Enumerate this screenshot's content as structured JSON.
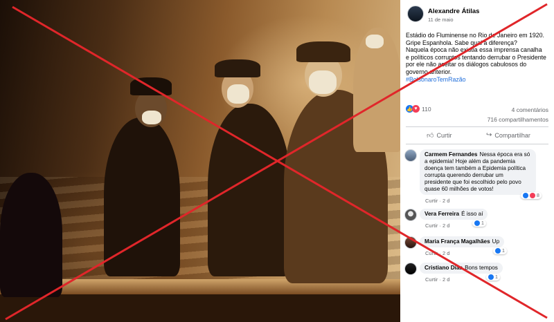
{
  "post": {
    "author": "Alexandre Átilas",
    "time": "11 de maio",
    "text_lines": [
      "Estádio do Fluminense no Rio de Janeiro em 1920.",
      "Gripe Espanhola. Sabe qual a diferença?",
      "Naquela época não existia essa imprensa canalha",
      "e políticos corruptos tentando derrubar o Presidente",
      "por ele não aceitar os diálogos cabulosos do",
      "governo anterior."
    ],
    "hashtag": "#BolsonaroTemRazão",
    "reaction_count": "110",
    "comments_count": "4 comentários",
    "shares_count": "716 compartilhamentos",
    "like_label": "Curtir",
    "share_label": "Compartilhar"
  },
  "comments": [
    {
      "name": "Carmem Fernandes",
      "text": "Nessa época era só a epidemia! Hoje além da pandemia doença tem também a Epidemia política corrupta querendo derrubar um presidente que foi escolhido pelo povo quase 60 milhões de votos!",
      "meta": "Curtir · 2 d",
      "reactions": "8"
    },
    {
      "name": "Vera Ferreira",
      "text": "É isso aí",
      "meta": "Curtir · 2 d",
      "reactions": "1"
    },
    {
      "name": "Maria França Magalhães",
      "text": "Up",
      "meta": "Curtir · 2 d",
      "reactions": "1"
    },
    {
      "name": "Cristiano Dias",
      "text": "Bons tempos",
      "meta": "Curtir · 2 d",
      "reactions": "1"
    }
  ],
  "icons": {
    "like": "thumbs-up-icon",
    "love": "heart-icon",
    "share": "share-arrow-icon"
  },
  "colors": {
    "cross": "#e0262a",
    "facebook_blue": "#1877f2",
    "love_red": "#f33e58",
    "hashtag": "#216fdb"
  }
}
